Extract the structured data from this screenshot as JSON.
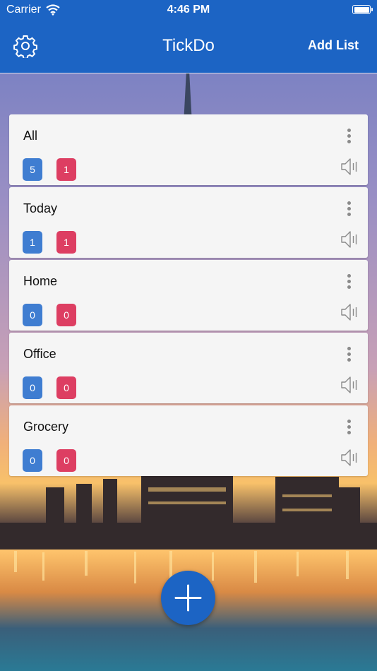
{
  "status_bar": {
    "carrier": "Carrier",
    "time": "4:46 PM"
  },
  "nav": {
    "title": "TickDo",
    "add_list_label": "Add List",
    "settings_icon": "gear-icon"
  },
  "lists": [
    {
      "name": "All",
      "blue_count": "5",
      "red_count": "1"
    },
    {
      "name": "Today",
      "blue_count": "1",
      "red_count": "1"
    },
    {
      "name": "Home",
      "blue_count": "0",
      "red_count": "0"
    },
    {
      "name": "Office",
      "blue_count": "0",
      "red_count": "0"
    },
    {
      "name": "Grocery",
      "blue_count": "0",
      "red_count": "0"
    }
  ],
  "colors": {
    "brand": "#1c64c4",
    "blue_badge": "#3f7dd1",
    "red_badge": "#dd3e62",
    "card": "#f5f5f5"
  },
  "icons": {
    "menu": "more-vertical-icon",
    "speaker": "speaker-icon",
    "add": "plus-icon"
  }
}
